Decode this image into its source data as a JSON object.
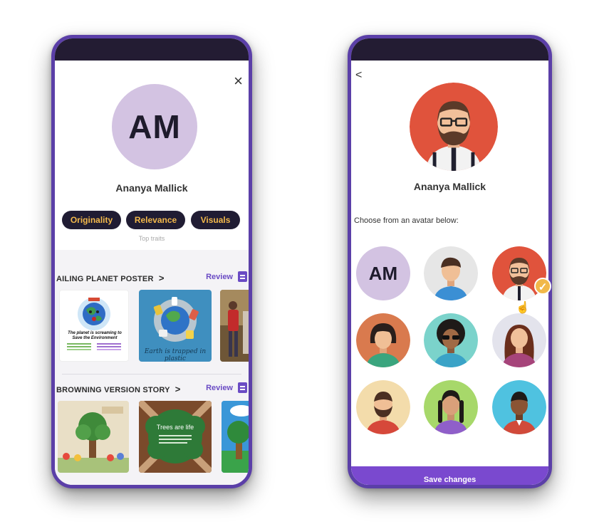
{
  "profile_screen": {
    "close_icon": "×",
    "initials": "AM",
    "name": "Ananya Mallick",
    "traits": [
      "Originality",
      "Relevance",
      "Visuals"
    ],
    "traits_caption": "Top traits",
    "sections": [
      {
        "title": "AILING PLANET POSTER",
        "chevron": ">",
        "action": "Review",
        "thumb_texts": [
          "The planet is screaming to Save the Environment",
          "Earth is trapped in plastic"
        ]
      },
      {
        "title": "BROWNING VERSION STORY",
        "chevron": ">",
        "action": "Review",
        "thumb_texts": [
          "Trees are life"
        ]
      }
    ]
  },
  "avatar_screen": {
    "back_icon": "<",
    "name": "Ananya Mallick",
    "choose_label": "Choose from an avatar below:",
    "avatar_initials": "AM",
    "save_label": "Save changes",
    "selected_avatar": "bearded-man-glasses",
    "avatars": [
      "initials-am",
      "man-short-hair",
      "bearded-man-glasses",
      "woman-bob",
      "man-sunglasses-afro",
      "woman-long-hair",
      "bearded-man",
      "woman-braids",
      "man-dark-skin"
    ]
  },
  "colors": {
    "frame": "#5b3fa8",
    "trait_bg": "#201c33",
    "trait_text": "#f2b84b",
    "accent": "#6a4bc4",
    "save_bar": "#7a49cf"
  }
}
